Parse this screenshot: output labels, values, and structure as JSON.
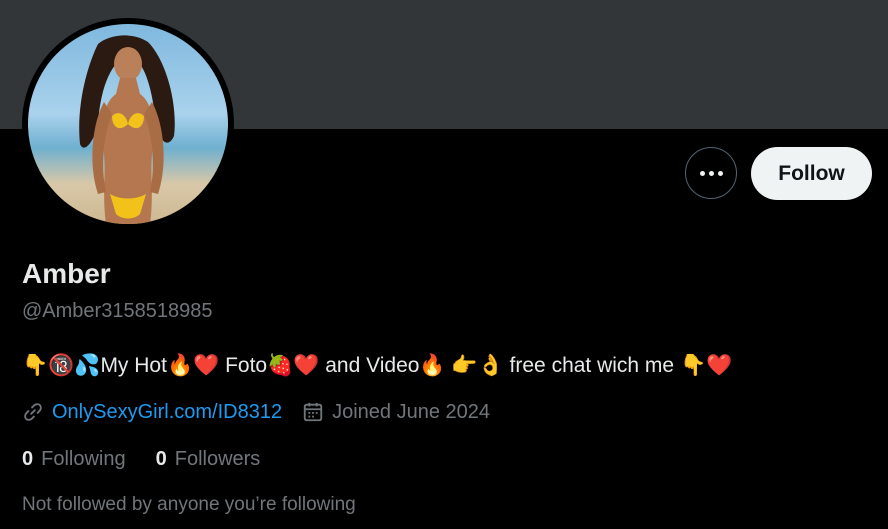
{
  "profile": {
    "display_name": "Amber",
    "handle": "@Amber3158518985",
    "bio": "👇🔞💦My Hot🔥❤️ Foto🍓❤️ and Video🔥 👉👌 free chat wich me 👇❤️",
    "link": "OnlySexyGirl.com/ID8312",
    "joined": "Joined June 2024",
    "following_count": "0",
    "following_label": "Following",
    "followers_count": "0",
    "followers_label": "Followers",
    "not_followed_text": "Not followed by anyone you’re following"
  },
  "actions": {
    "follow_label": "Follow",
    "more_icon": "more-horizontal-icon"
  },
  "icons": {
    "link": "link-icon",
    "calendar": "calendar-icon"
  },
  "colors": {
    "background": "#000000",
    "banner": "#333639",
    "link": "#1d9bf0",
    "secondary_text": "#71767b",
    "primary_text": "#e7e9ea",
    "follow_button_bg": "#eff3f4"
  }
}
